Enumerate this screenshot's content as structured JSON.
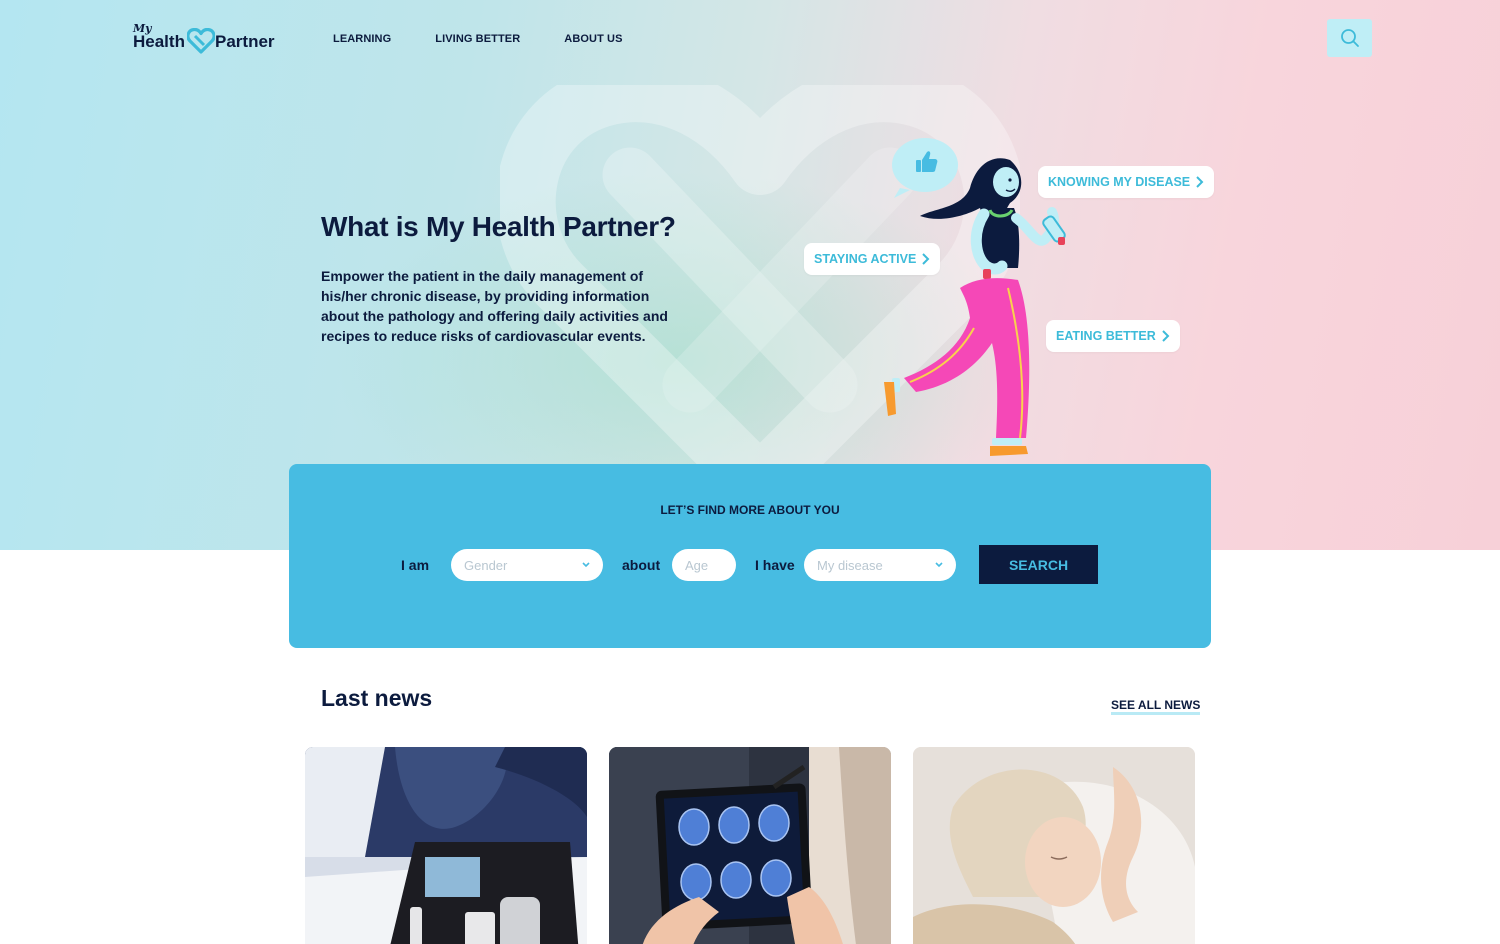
{
  "brand": {
    "logo_my": "My",
    "logo_health": "Health",
    "logo_partner": "Partner"
  },
  "nav": {
    "items": [
      "LEARNING",
      "LIVING BETTER",
      "ABOUT US"
    ]
  },
  "hero": {
    "title": "What is My Health Partner?",
    "text": "Empower the patient in the daily management of his/her chronic disease, by providing information about the pathology and offering daily activities and recipes to reduce risks of cardiovascular events.",
    "bubbles": [
      "KNOWING MY DISEASE",
      "STAYING ACTIVE",
      "EATING BETTER"
    ]
  },
  "finder": {
    "title": "LET’S FIND MORE ABOUT YOU",
    "label_iam": "I am",
    "gender_placeholder": "Gender",
    "label_about": "about",
    "age_placeholder": "Age",
    "label_ihave": "I have",
    "disease_placeholder": "My disease",
    "search_label": "SEARCH"
  },
  "news": {
    "title": "Last news",
    "see_all": "SEE ALL NEWS",
    "cards": [
      {
        "image": "diabetes-kit-photo"
      },
      {
        "image": "brain-scan-tablet-photo"
      },
      {
        "image": "sleeping-woman-photo"
      }
    ]
  },
  "colors": {
    "navy": "#0c1b3e",
    "accent": "#47bce2",
    "bubble_text": "#3dbbd9"
  }
}
